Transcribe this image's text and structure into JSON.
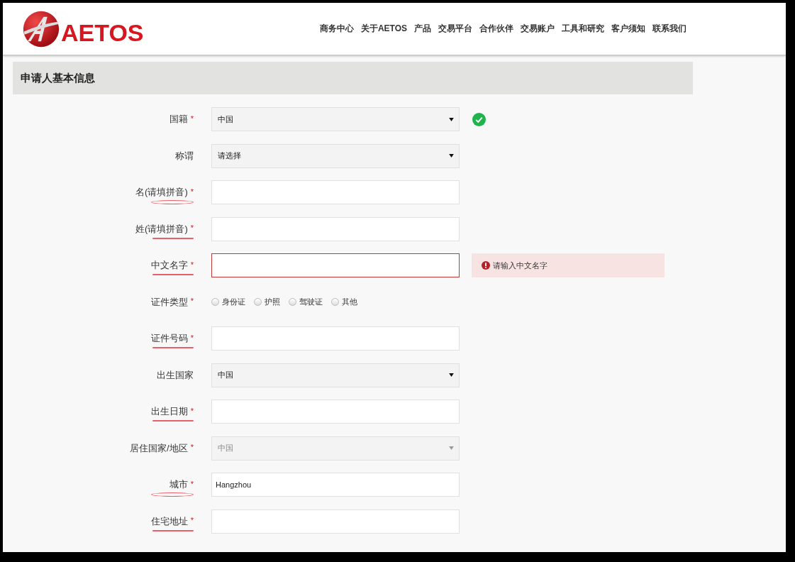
{
  "header": {
    "logo_text": "AETOS",
    "nav": [
      "商务中心",
      "关于AETOS",
      "产品",
      "交易平台",
      "合作伙伴",
      "交易账户",
      "工具和研究",
      "客户须知",
      "联系我们"
    ]
  },
  "section": {
    "title": "申请人基本信息"
  },
  "fields": [
    {
      "kind": "select",
      "label": "国籍",
      "required_mark": "*",
      "value": "中国",
      "valid": true
    },
    {
      "kind": "select",
      "label": "称谓",
      "value": "请选择"
    },
    {
      "kind": "text",
      "label": "名(请填拼音)",
      "required_mark": "*",
      "circled": true
    },
    {
      "kind": "text",
      "label": "姓(请填拼音)",
      "required_mark": "*",
      "underlined": true
    },
    {
      "kind": "text",
      "label": "中文名字",
      "required_mark": "*",
      "underlined": true,
      "error": "请输入中文名字"
    },
    {
      "kind": "radio",
      "label": "证件类型",
      "required_mark": "*",
      "options": [
        {
          "label": "身份证",
          "selected": false
        },
        {
          "label": "护照",
          "selected": false
        },
        {
          "label": "驾驶证",
          "selected": false
        },
        {
          "label": "其他",
          "selected": false
        }
      ]
    },
    {
      "kind": "text",
      "label": "证件号码",
      "required_mark": "*",
      "underlined": true
    },
    {
      "kind": "select",
      "label": "出生国家",
      "value": "中国"
    },
    {
      "kind": "text",
      "label": "出生日期",
      "required_mark": "*",
      "underlined": true
    },
    {
      "kind": "select",
      "label": "居住国家/地区",
      "required_mark": "*",
      "value": "中国",
      "disabled": true
    },
    {
      "kind": "text",
      "label": "城市",
      "required_mark": "*",
      "value": "Hangzhou",
      "circled": true
    },
    {
      "kind": "text",
      "label": "住宅地址",
      "required_mark": "*",
      "underlined": true
    }
  ]
}
